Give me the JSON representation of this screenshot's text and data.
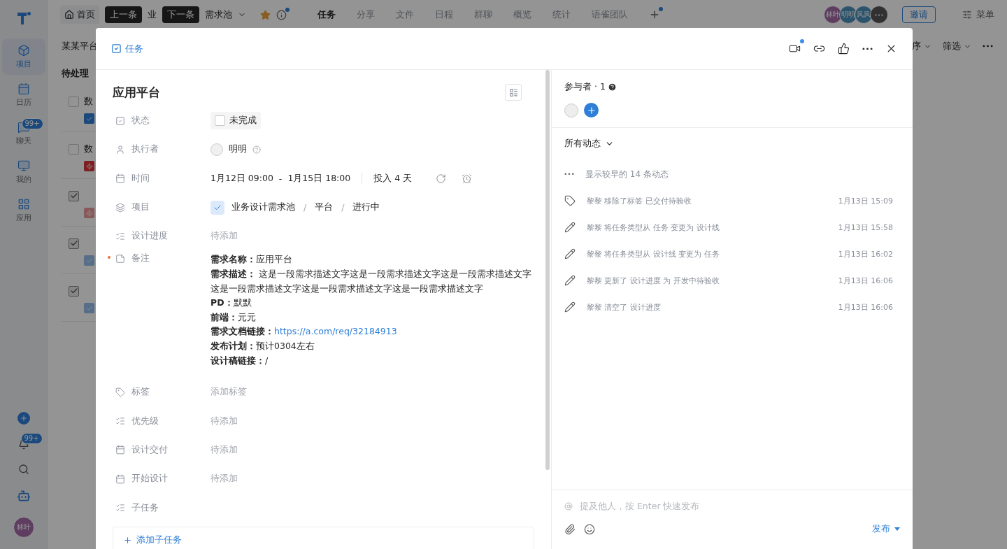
{
  "rail": {
    "items": [
      {
        "label": "项目",
        "selected": true
      },
      {
        "label": "日历",
        "selected": false
      },
      {
        "label": "聊天",
        "selected": false,
        "badge": "99+"
      },
      {
        "label": "我的",
        "selected": false
      },
      {
        "label": "应用",
        "selected": false
      }
    ],
    "bottom": [
      {
        "kind": "add"
      },
      {
        "kind": "notice",
        "badge": "99+"
      },
      {
        "kind": "search"
      },
      {
        "kind": "bot"
      },
      {
        "kind": "avatar",
        "label": "林叶"
      }
    ]
  },
  "topbar": {
    "home": "首页",
    "tooltips": [
      "上一条",
      "下一条"
    ],
    "crumb_parts": [
      "业",
      "需求池"
    ],
    "tabs": [
      {
        "label": "任务",
        "selected": true
      },
      {
        "label": "分享",
        "selected": false
      },
      {
        "label": "文件",
        "selected": false
      },
      {
        "label": "日程",
        "selected": false
      },
      {
        "label": "群聊",
        "selected": false
      },
      {
        "label": "概览",
        "selected": false
      },
      {
        "label": "统计",
        "selected": false
      },
      {
        "label": "语雀团队",
        "selected": false
      }
    ],
    "members": [
      {
        "label": "林叶"
      },
      {
        "label": "明明"
      },
      {
        "label": "风风"
      }
    ],
    "invite": "邀请",
    "menu": "菜单"
  },
  "subbar": {
    "title": "某某平台",
    "sort": "序",
    "filter": "筛选"
  },
  "list": {
    "heading": "待处理",
    "cards": [
      {
        "text": "数",
        "checked": false,
        "kind": "task"
      },
      {
        "text": "数",
        "checked": false,
        "kind": "urgent"
      },
      {
        "checked": true,
        "kind": "urgent"
      },
      {
        "checked": true,
        "kind": "task"
      },
      {
        "checked": true,
        "kind": "task"
      }
    ]
  },
  "modal": {
    "type_label": "任务",
    "title": "应用平台",
    "fields": [
      {
        "kind": "status",
        "label": "状态",
        "value": "未完成",
        "checked": false
      },
      {
        "kind": "person",
        "label": "执行者",
        "value": "明明"
      },
      {
        "kind": "time",
        "label": "时间",
        "start": "1月12日 09:00",
        "sep": "-",
        "end": "1月15日 18:00",
        "effort": "投入 4 天"
      },
      {
        "kind": "project",
        "label": "项目",
        "parts": [
          "业务设计需求池",
          "/",
          "平台",
          "/",
          "进行中"
        ]
      },
      {
        "kind": "empty",
        "label": "设计进度",
        "value": "待添加"
      },
      {
        "kind": "notes",
        "label": "备注",
        "required": true,
        "lines": [
          {
            "label": "需求名称：",
            "value": "应用平台"
          },
          {
            "label": "需求描述：",
            "value": " 这是一段需求描述文字这是一段需求描述文字这是一段需求描述文字",
            "continuation": "这是一段需求描述文字这是一段需求描述文字这是一段需求描述文字"
          },
          {
            "label": "PD：",
            "value": "默默"
          },
          {
            "label": "前端：",
            "value": "元元"
          },
          {
            "label": "需求文档链接：",
            "link": "https://a.com/req/32184913"
          },
          {
            "label": "发布计划：",
            "value": "预计0304左右"
          },
          {
            "label": "设计稿链接：",
            "value": "/"
          }
        ]
      },
      {
        "kind": "empty",
        "label": "标签",
        "value": "添加标签"
      },
      {
        "kind": "empty",
        "label": "优先级",
        "value": "待添加"
      },
      {
        "kind": "empty",
        "label": "设计交付",
        "value": "待添加"
      },
      {
        "kind": "empty",
        "label": "开始设计",
        "value": "待添加"
      },
      {
        "kind": "label",
        "label": "子任务"
      }
    ],
    "add_subtask": "添加子任务",
    "participants": {
      "title": "参与者 · 1"
    },
    "activity": {
      "filter": "所有动态",
      "more": "显示较早的 14 条动态",
      "items": [
        {
          "kind": "tag",
          "text": "黎黎 移除了标签 已交付待验收",
          "time": "1月13日 15:09"
        },
        {
          "kind": "edit",
          "text": "黎黎 将任务类型从 任务 变更为 设计线",
          "time": "1月13日 15:58"
        },
        {
          "kind": "edit",
          "text": "黎黎 将任务类型从 设计线 变更为 任务",
          "time": "1月13日 16:02"
        },
        {
          "kind": "edit",
          "text": "黎黎 更新了 设计进度 为 开发中待验收",
          "time": "1月13日 16:06"
        },
        {
          "kind": "edit",
          "text": "黎黎 清空了 设计进度",
          "time": "1月13日 16:06"
        }
      ]
    },
    "composer": {
      "placeholder": "提及他人，按 Enter 快速发布",
      "submit": "发布"
    }
  }
}
